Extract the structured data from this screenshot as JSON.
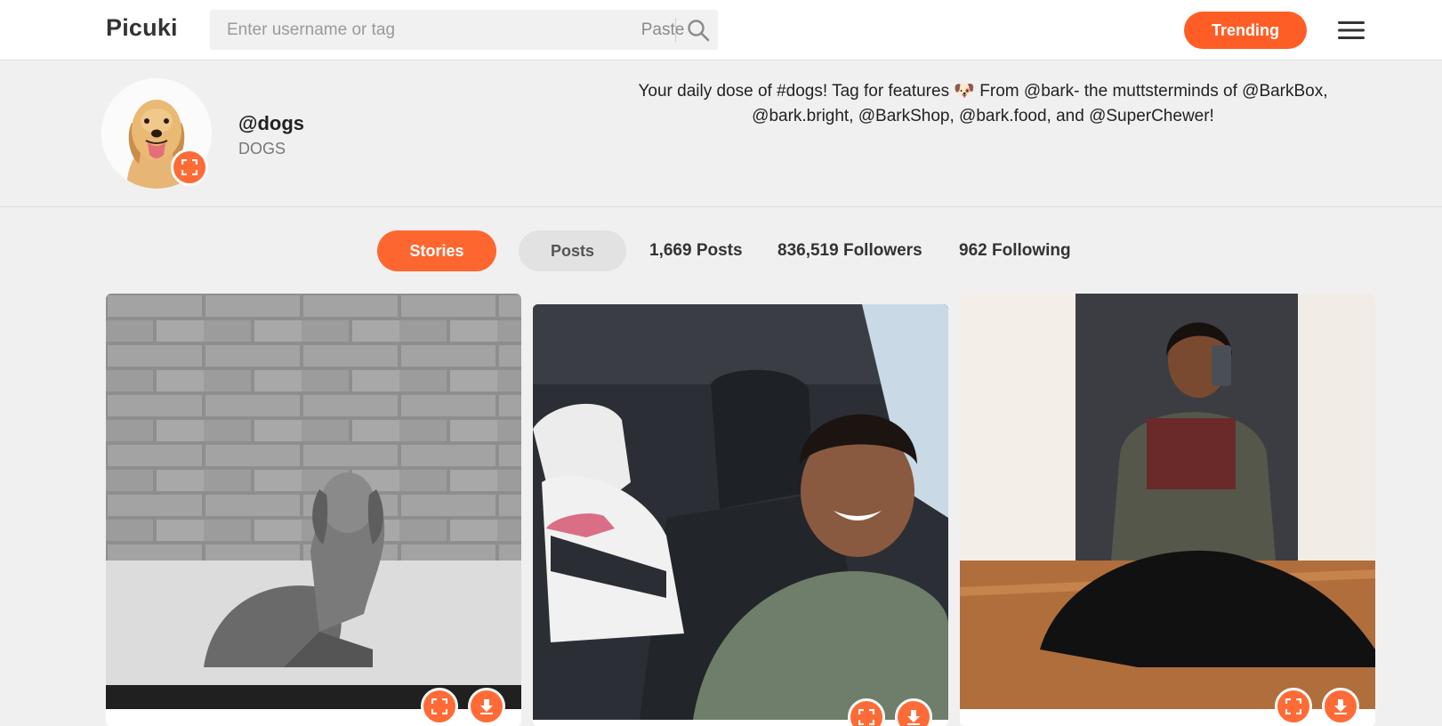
{
  "app": {
    "logo": "Picuki"
  },
  "search": {
    "placeholder": "Enter username or tag",
    "value": "",
    "paste_label": "Paste"
  },
  "nav": {
    "trending_label": "Trending"
  },
  "profile": {
    "username": "@dogs",
    "full_name": "DOGS",
    "bio_line1": "Your daily dose of #dogs! Tag for features 🐶 From @bark- the muttsterminds of @BarkBox,",
    "bio_line2": "@bark.bright, @BarkShop, @bark.food, and @SuperChewer!"
  },
  "tabs": {
    "stories_label": "Stories",
    "posts_label": "Posts"
  },
  "stats": {
    "posts": "1,669 Posts",
    "followers": "836,519 Followers",
    "following": "962 Following"
  },
  "colors": {
    "accent": "#fe6630",
    "background": "#f0f0f0",
    "tab_inactive": "#e2e2e2"
  },
  "icons": [
    "search-icon",
    "hamburger-menu-icon",
    "expand-icon",
    "download-icon"
  ]
}
